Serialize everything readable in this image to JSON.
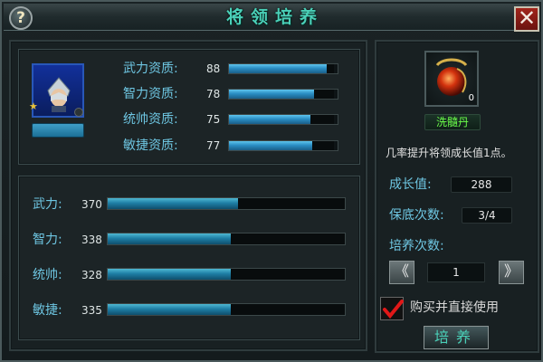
{
  "window": {
    "title": "将领培养",
    "help_label": "?",
    "close_label": "✕"
  },
  "general": {
    "avatar_icon": "warrior-portrait"
  },
  "aptitudes": [
    {
      "label": "武力资质:",
      "value": "88",
      "fill": 0.9
    },
    {
      "label": "智力资质:",
      "value": "78",
      "fill": 0.78
    },
    {
      "label": "统帅资质:",
      "value": "75",
      "fill": 0.75
    },
    {
      "label": "敏捷资质:",
      "value": "77",
      "fill": 0.77
    }
  ],
  "stats": [
    {
      "label": "武力:",
      "value": "370",
      "fill": 0.55
    },
    {
      "label": "智力:",
      "value": "338",
      "fill": 0.52
    },
    {
      "label": "统帅:",
      "value": "328",
      "fill": 0.52
    },
    {
      "label": "敏捷:",
      "value": "335",
      "fill": 0.52
    }
  ],
  "item": {
    "name": "洗髓丹",
    "count": "0",
    "icon": "red-orb-icon",
    "description": "几率提升将领成长值1点。"
  },
  "growth": {
    "label": "成长值:",
    "value": "288"
  },
  "guarantee": {
    "label": "保底次数:",
    "value": "3/4"
  },
  "train_count": {
    "label": "培养次数:",
    "value": "1",
    "dec_label": "《",
    "inc_label": "》"
  },
  "auto_buy": {
    "label": "购买并直接使用",
    "checked": true
  },
  "train_button": {
    "label": "培养"
  },
  "colors": {
    "accent": "#4ad0b8",
    "label_blue": "#6ec6e2",
    "bar_blue": "#2a8ec4",
    "item_green": "#6bff4a"
  }
}
